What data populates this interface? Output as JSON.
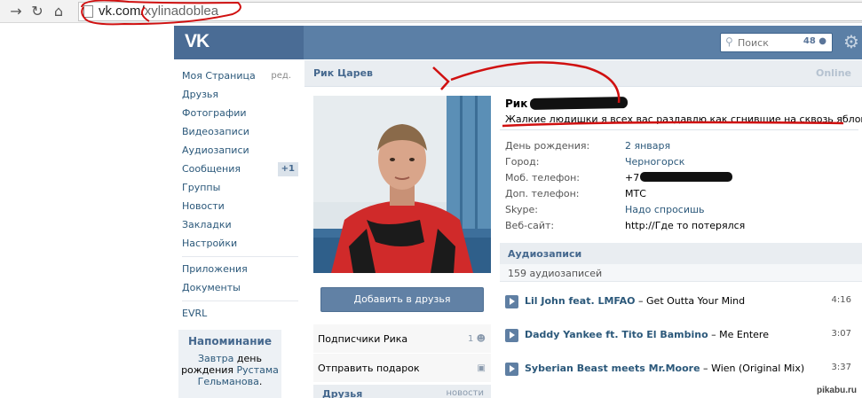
{
  "browser": {
    "url_host": "vk.com/",
    "url_path": "xylinadoblea"
  },
  "header": {
    "logo": "VK",
    "search_placeholder": "Поиск",
    "search_count": "48"
  },
  "sidebar": {
    "edit_label": "ред.",
    "items": [
      {
        "label": "Моя Страница"
      },
      {
        "label": "Друзья"
      },
      {
        "label": "Фотографии"
      },
      {
        "label": "Видеозаписи"
      },
      {
        "label": "Аудиозаписи"
      },
      {
        "label": "Сообщения",
        "badge": "+1"
      },
      {
        "label": "Группы"
      },
      {
        "label": "Новости"
      },
      {
        "label": "Закладки"
      },
      {
        "label": "Настройки"
      },
      {
        "label": "Приложения"
      },
      {
        "label": "Документы"
      },
      {
        "label": "EVRL"
      }
    ],
    "reminder": {
      "title": "Напоминание",
      "link1": "Завтра",
      "text1": "день рождения",
      "link2": "Рустама Гельманова",
      "end": "."
    }
  },
  "profile": {
    "title_name": "Рик Царев",
    "online": "Online",
    "name_visible": "Рик",
    "status": "Жалкие людишки я всех вас раздавлю как сгнившие на сквозь яблоки!",
    "add_friend": "Добавить в друзья",
    "actions": [
      {
        "label": "Подписчики Рика",
        "right": "1"
      },
      {
        "label": "Отправить подарок",
        "right": ""
      }
    ],
    "friends_head": "Друзья",
    "friends_head_right": "новости",
    "info": [
      {
        "key": "День рождения:",
        "value": "2 января",
        "link": true
      },
      {
        "key": "Город:",
        "value": "Черногорск",
        "link": true
      },
      {
        "key": "Моб. телефон:",
        "value": "+7",
        "link": false
      },
      {
        "key": "Доп. телефон:",
        "value": "МТС",
        "link": false
      },
      {
        "key": "Skype:",
        "value": "Надо спросишь",
        "link": true
      },
      {
        "key": "Веб-сайт:",
        "value": "http://Где то потерялся",
        "link": false
      }
    ]
  },
  "audio": {
    "title": "Аудиозаписи",
    "count": "159 аудиозаписей",
    "tracks": [
      {
        "artist": "Lil John feat. LMFAO",
        "dash": " – ",
        "song": "Get Outta Your Mind",
        "duration": "4:16"
      },
      {
        "artist": "Daddy Yankee ft. Tito El Bambino",
        "dash": " – ",
        "song": "Me Entere",
        "duration": "3:07"
      },
      {
        "artist": "Syberian Beast meets Mr.Moore",
        "dash": " – ",
        "song": "Wien (Original Mix)",
        "duration": "3:37"
      }
    ]
  },
  "watermark": "pikabu.ru",
  "colors": {
    "vk_header": "#5b7fa6",
    "link": "#2b587a",
    "annotation_red": "#d01010"
  }
}
